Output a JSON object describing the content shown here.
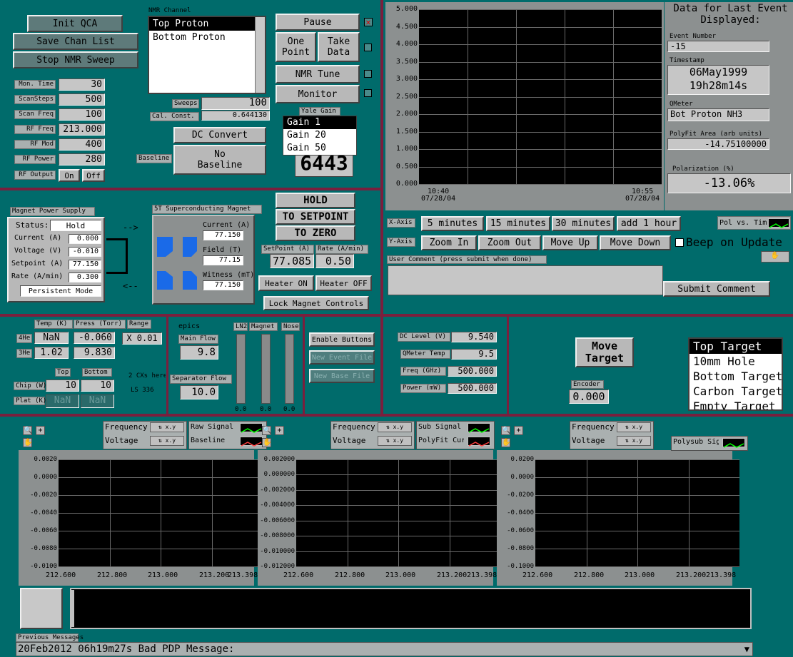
{
  "top_left": {
    "buttons": [
      "Init QCA",
      "Save Chan List",
      "Stop NMR Sweep"
    ],
    "params": [
      {
        "label": "Mon. Time",
        "value": "30"
      },
      {
        "label": "ScanSteps",
        "value": "500"
      },
      {
        "label": "Scan Freq",
        "value": "100"
      },
      {
        "label": "RF Freq",
        "value": "213.000"
      },
      {
        "label": "RF Mod",
        "value": "400"
      },
      {
        "label": "RF Power",
        "value": "280"
      }
    ],
    "rf_output": {
      "label": "RF Output",
      "on": "On",
      "off": "Off"
    }
  },
  "nmr": {
    "channel_label": "NMR Channel",
    "channels": [
      "Top Proton",
      "Bottom Proton"
    ],
    "sweeps_label": "Sweeps",
    "sweeps_value": "100",
    "cal_label": "Cal. Const.",
    "cal_value": "0.644130",
    "buttons": {
      "pause": "Pause",
      "one_point": "One Point",
      "take_data": "Take Data",
      "nmr_tune": "NMR Tune",
      "monitor": "Monitor"
    },
    "yale_gain_label": "Yale Gain",
    "gains": [
      "Gain 1",
      "Gain 20",
      "Gain 50"
    ],
    "counter": "6443",
    "dc_convert": "DC Convert",
    "baseline_label": "Baseline",
    "no_baseline": "No Baseline"
  },
  "pol_chart": {
    "yticks": [
      "5.000",
      "4.500",
      "4.000",
      "3.500",
      "3.000",
      "2.500",
      "2.000",
      "1.500",
      "1.000",
      "0.500",
      "0.000"
    ],
    "x_start": "10:40\n07/28/04",
    "x_end": "10:55\n07/28/04",
    "ylim": [
      0,
      5
    ]
  },
  "event": {
    "title": "Data for Last Event Displayed:",
    "event_number_label": "Event Number",
    "event_number": "-15",
    "timestamp_label": "Timestamp",
    "timestamp_date": "06May1999",
    "timestamp_time": "19h28m14s",
    "qmeter_label": "QMeter",
    "qmeter": "Bot Proton NH3",
    "area_label": "PolyFit Area (arb units)",
    "area": "-14.75100000",
    "pol_label": "Polarization (%)",
    "pol": "-13.06%"
  },
  "axis_controls": {
    "x_label": "X-Axis",
    "x_buttons": [
      "5 minutes",
      "15 minutes",
      "30 minutes",
      "add 1 hour"
    ],
    "y_label": "Y-Axis",
    "y_buttons": [
      "Zoom In",
      "Zoom Out",
      "Move Up",
      "Move Down"
    ],
    "pol_vs_time": "Pol vs. Tim",
    "beep": "Beep on Update"
  },
  "comment": {
    "label": "User Comment (press submit when done)",
    "submit": "Submit Comment"
  },
  "magnet_ps": {
    "title": "Magnet Power Supply",
    "status_label": "Status:",
    "status": "Hold",
    "rows": [
      {
        "label": "Current (A)",
        "value": "0.000"
      },
      {
        "label": "Voltage (V)",
        "value": "-0.010"
      },
      {
        "label": "Setpoint (A)",
        "value": "77.150"
      },
      {
        "label": "Rate (A/min)",
        "value": "0.300"
      }
    ],
    "mode": "Persistent Mode"
  },
  "sc_magnet": {
    "title": "5T Superconducting Magnet",
    "current_label": "Current (A)",
    "current": "77.150",
    "field_label": "Field (T)",
    "field": "77.15",
    "witness_label": "Witness (mT)",
    "witness": "77.150"
  },
  "magnet_ctrl": {
    "hold": "HOLD",
    "to_setpoint": "TO SETPOINT",
    "to_zero": "TO ZERO",
    "setpoint_label": "SetPoint (A)",
    "setpoint": "77.085",
    "rate_label": "Rate (A/min)",
    "rate": "0.50",
    "heater_on": "Heater ON",
    "heater_off": "Heater OFF",
    "lock": "Lock Magnet Controls"
  },
  "cryo": {
    "headers": [
      "Temp (K)",
      "Press (Torr)",
      "Range"
    ],
    "rows": [
      {
        "label": "4He",
        "temp": "NaN",
        "press": "-0.060",
        "range": "X 0.01"
      },
      {
        "label": "3He",
        "temp": "1.02",
        "press": "9.830"
      }
    ],
    "top_label": "Top",
    "bottom_label": "Bottom",
    "chip_label": "Chip (W)",
    "chip_top": "10",
    "chip_bottom": "10",
    "plat_label": "Plat (K)",
    "plat_top": "NaN",
    "plat_bottom": "NaN",
    "cx_note": "2 CXs here",
    "ls_note": "LS 336"
  },
  "epics": {
    "title": "epics",
    "main_flow_label": "Main Flow",
    "main_flow": "9.8",
    "sep_flow_label": "Separator Flow",
    "sep_flow": "10.0",
    "bars": [
      {
        "label": "LN2",
        "value": "0.0"
      },
      {
        "label": "Magnet",
        "value": "0.0"
      },
      {
        "label": "Nose",
        "value": "0.0"
      }
    ]
  },
  "file_buttons": [
    "Enable Buttons",
    "New Event File",
    "New Base File"
  ],
  "microwave": {
    "rows": [
      {
        "label": "DC Level (V)",
        "value": "9.540"
      },
      {
        "label": "QMeter Temp",
        "value": "9.5"
      },
      {
        "label": "Freq (GHz)",
        "value": "500.000"
      },
      {
        "label": "Power (mW)",
        "value": "500.000"
      }
    ]
  },
  "target": {
    "move": "Move Target",
    "encoder_label": "Encoder",
    "encoder": "0.000",
    "items": [
      "Top Target",
      "10mm Hole",
      "Bottom Target",
      "Carbon Target",
      "Empty Target"
    ]
  },
  "plots": [
    {
      "legend_axes": [
        "Frequency",
        "Voltage"
      ],
      "series": [
        "Raw Signal",
        "Baseline"
      ],
      "series_colors": [
        "#00ff00",
        "#ff4040"
      ],
      "yticks": [
        "0.0020",
        "0.0000",
        "-0.0020",
        "-0.0040",
        "-0.0060",
        "-0.0080",
        "-0.0100"
      ],
      "xticks": [
        "212.600",
        "212.800",
        "213.000",
        "213.200",
        "213.398"
      ]
    },
    {
      "legend_axes": [
        "Frequency",
        "Voltage"
      ],
      "series": [
        "Sub Signal",
        "PolyFit Curve"
      ],
      "series_colors": [
        "#00ff00",
        "#ff4040"
      ],
      "yticks": [
        "0.002000",
        "0.000000",
        "-0.002000",
        "-0.004000",
        "-0.006000",
        "-0.008000",
        "-0.010000",
        "-0.012000"
      ],
      "xticks": [
        "212.600",
        "212.800",
        "213.000",
        "213.200",
        "213.398"
      ]
    },
    {
      "legend_axes": [
        "Frequency",
        "Voltage"
      ],
      "series": [
        "Polysub Signal"
      ],
      "series_colors": [
        "#00ff00"
      ],
      "yticks": [
        "0.0200",
        "0.0000",
        "-0.0200",
        "-0.0400",
        "-0.0600",
        "-0.0800",
        "-0.1000"
      ],
      "xticks": [
        "212.600",
        "212.800",
        "213.000",
        "213.200",
        "213.398"
      ]
    }
  ],
  "messages": {
    "prev_label": "Previous Messages",
    "text": "20Feb2012 06h19m27s Bad PDP Message:"
  },
  "colors": {
    "panel": "#006b6b",
    "separator": "#7a1f3d",
    "plot_bg": "#000000"
  }
}
